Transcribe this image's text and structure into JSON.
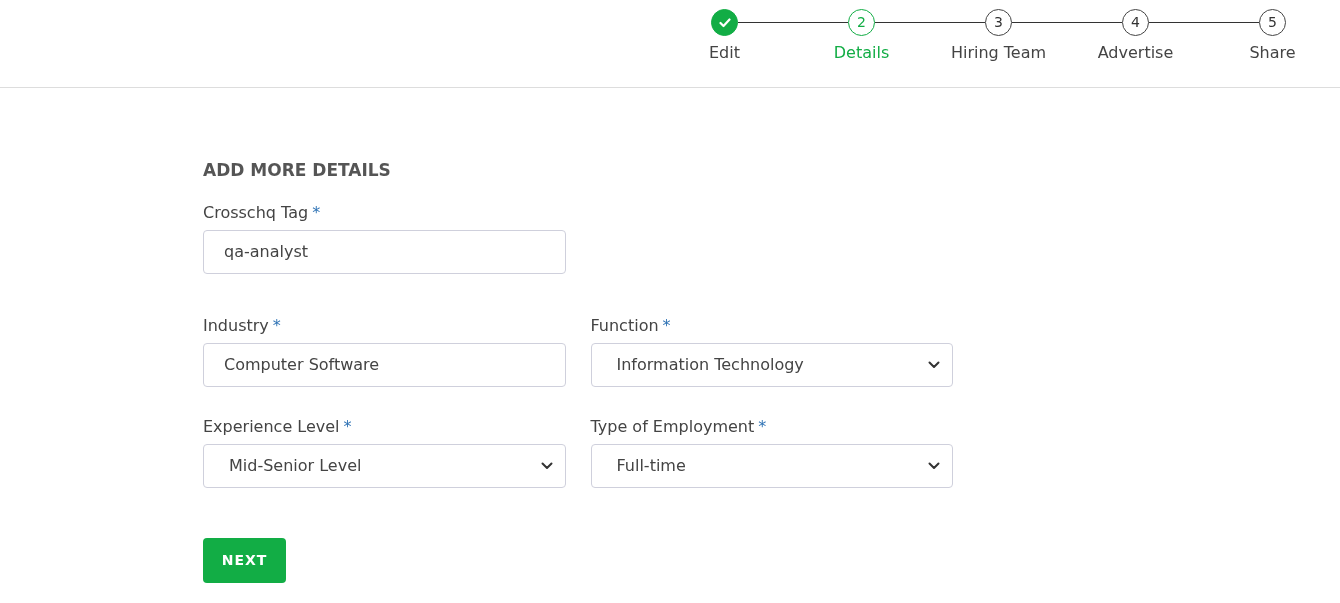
{
  "stepper": [
    {
      "label": "Edit",
      "completed": true,
      "selected": false
    },
    {
      "number": "2",
      "label": "Details",
      "completed": false,
      "selected": true
    },
    {
      "number": "3",
      "label": "Hiring Team",
      "completed": false,
      "selected": false
    },
    {
      "number": "4",
      "label": "Advertise",
      "completed": false,
      "selected": false
    },
    {
      "number": "5",
      "label": "Share",
      "completed": false,
      "selected": false
    }
  ],
  "form": {
    "heading": "ADD MORE DETAILS",
    "rows": [
      [
        {
          "kind": "text",
          "label": "Crosschq Tag",
          "required_mark": "*",
          "value": "qa-analyst"
        }
      ],
      [
        {
          "kind": "text",
          "label": "Industry",
          "required_mark": "*",
          "value": "Computer Software"
        },
        {
          "kind": "select",
          "label": "Function",
          "required_mark": "*",
          "value": "Information Technology"
        }
      ],
      [
        {
          "kind": "select",
          "label": "Experience Level",
          "required_mark": "*",
          "value": "Mid-Senior Level"
        },
        {
          "kind": "select",
          "label": "Type of Employment",
          "required_mark": "*",
          "value": "Full-time"
        }
      ]
    ],
    "submit": "NEXT"
  }
}
